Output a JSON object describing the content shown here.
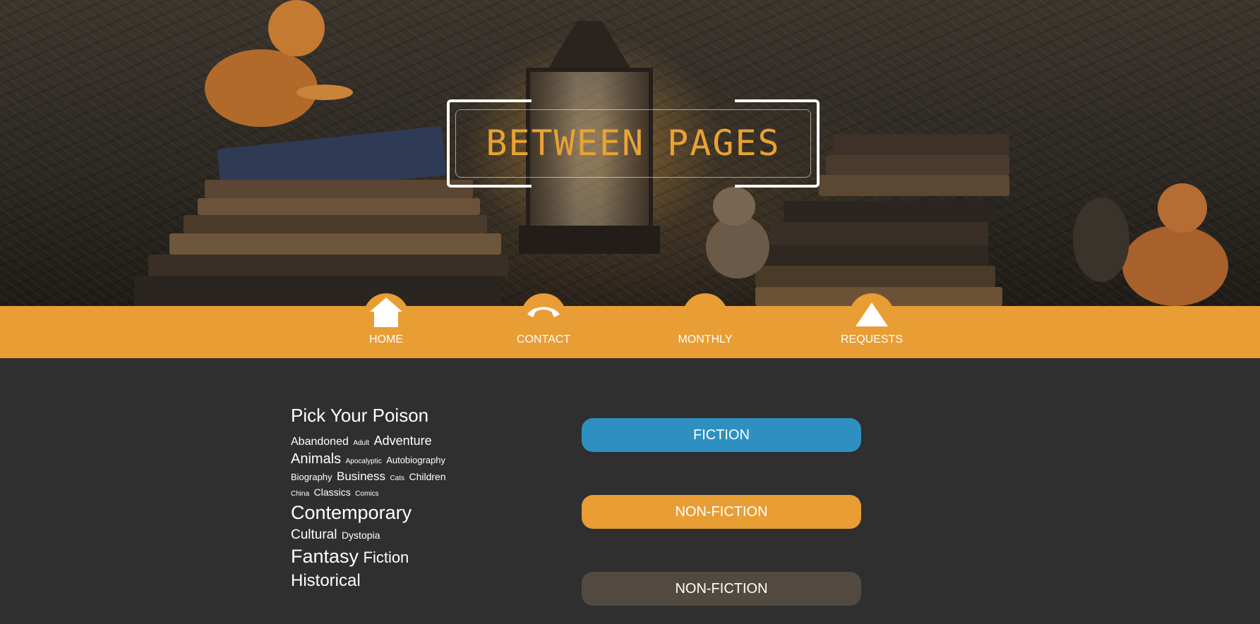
{
  "header": {
    "logo_text": "BETWEEN PAGES"
  },
  "nav": {
    "items": [
      {
        "label": "HOME",
        "icon": "house-icon"
      },
      {
        "label": "CONTACT",
        "icon": "phone-icon"
      },
      {
        "label": "MONTHLY",
        "icon": "calendar-icon"
      },
      {
        "label": "REQUESTS",
        "icon": "triangle-icon"
      }
    ]
  },
  "tags": {
    "heading": "Pick Your Poison",
    "items": [
      {
        "label": "Abandoned",
        "size": 16
      },
      {
        "label": "Adult",
        "size": 10
      },
      {
        "label": "Adventure",
        "size": 18
      },
      {
        "label": "Animals",
        "size": 20
      },
      {
        "label": "Apocalyptic",
        "size": 10
      },
      {
        "label": "Autobiography",
        "size": 13
      },
      {
        "label": "Biography",
        "size": 13
      },
      {
        "label": "Business",
        "size": 17
      },
      {
        "label": "Cats",
        "size": 10
      },
      {
        "label": "Children",
        "size": 14
      },
      {
        "label": "China",
        "size": 10
      },
      {
        "label": "Classics",
        "size": 14
      },
      {
        "label": "Comics",
        "size": 10
      },
      {
        "label": "Contemporary",
        "size": 27
      },
      {
        "label": "Cultural",
        "size": 19
      },
      {
        "label": "Dystopia",
        "size": 14
      },
      {
        "label": "Fantasy",
        "size": 27
      },
      {
        "label": "Fiction",
        "size": 22
      },
      {
        "label": "Historical",
        "size": 24
      }
    ]
  },
  "categories": [
    {
      "label": "FICTION",
      "color": "#2e90c1"
    },
    {
      "label": "NON-FICTION",
      "color": "#e99d35"
    },
    {
      "label": "NON-FICTION",
      "color": "#524a41"
    }
  ],
  "colors": {
    "accent": "#e99d35",
    "background": "#2f2f2f",
    "fiction_blue": "#2e90c1"
  }
}
